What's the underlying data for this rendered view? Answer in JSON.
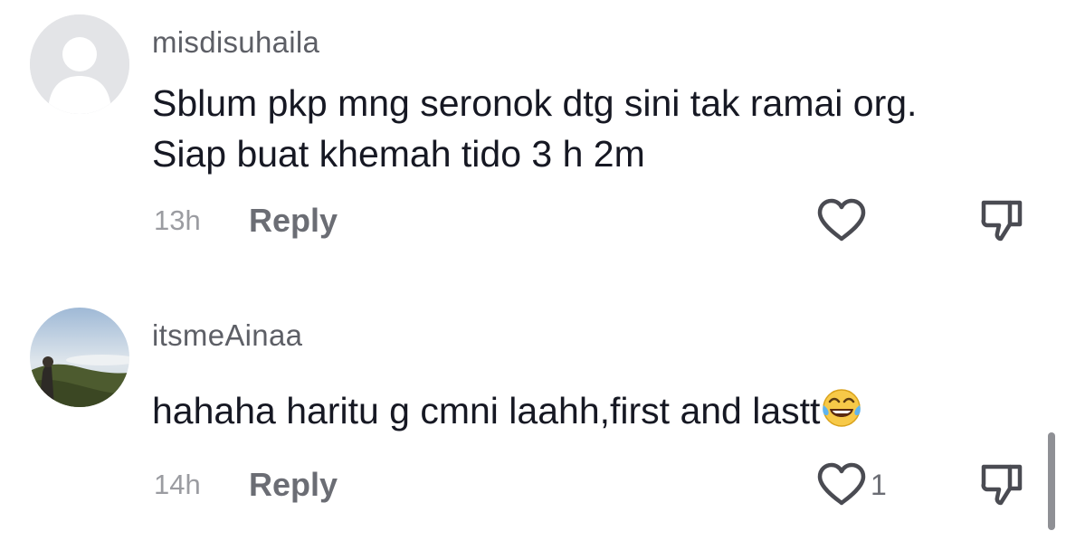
{
  "comments": [
    {
      "username": "misdisuhaila",
      "text_lines": [
        "Sblum pkp mng seronok dtg sini tak ramai org.",
        "Siap buat khemah tido 3 h 2m"
      ],
      "time": "13h",
      "reply_label": "Reply",
      "avatar": "default-user-avatar",
      "like_icon": "heart-outline-icon",
      "dislike_icon": "thumbs-down-outline-icon"
    },
    {
      "username": "itsmeAinaa",
      "text": "hahaha haritu g cmni laahh,first and lastt",
      "emoji": "tears-of-joy-emoji",
      "time": "14h",
      "reply_label": "Reply",
      "like_count": "1",
      "avatar": "photo-avatar",
      "like_icon": "heart-outline-icon",
      "dislike_icon": "thumbs-down-outline-icon"
    }
  ],
  "colors": {
    "username": "#5d5f66",
    "text": "#161823",
    "meta": "#9b9ca1",
    "reply": "#6b6d74",
    "icon_stroke": "#4a4b52",
    "avatar_placeholder": "#e3e4e7"
  }
}
